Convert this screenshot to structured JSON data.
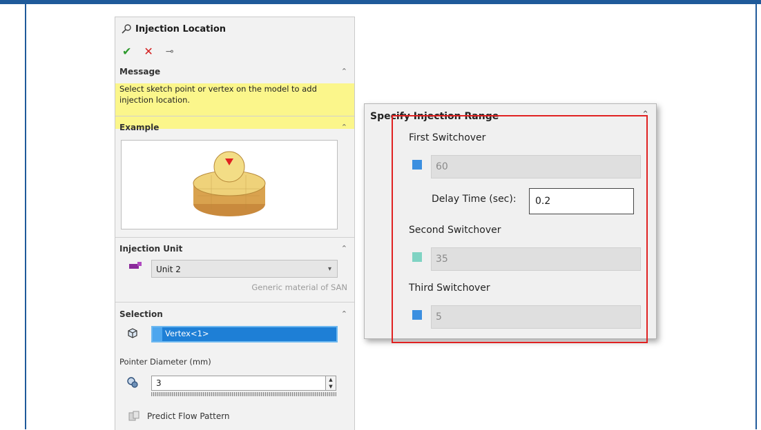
{
  "left_panel": {
    "title": "Injection Location",
    "actions": {
      "ok": "✔",
      "cancel": "✕",
      "pin": "⊸"
    },
    "message": {
      "header": "Message",
      "text": "Select sketch point or vertex on the model to add injection location."
    },
    "example": {
      "header": "Example"
    },
    "injection_unit": {
      "header": "Injection Unit",
      "selected": "Unit 2",
      "note": "Generic material of SAN"
    },
    "selection": {
      "header": "Selection",
      "value": "Vertex<1>",
      "pointer_diameter_label": "Pointer Diameter (mm)",
      "pointer_diameter_value": "3",
      "predict_label": "Predict Flow Pattern"
    }
  },
  "right_panel": {
    "title": "Specify Injection Range",
    "first_switchover": {
      "label": "First Switchover",
      "value": "60",
      "color": "#3b8fe0"
    },
    "delay": {
      "label": "Delay Time (sec):",
      "value": "0.2"
    },
    "second_switchover": {
      "label": "Second Switchover",
      "value": "35",
      "color": "#7fd3c3"
    },
    "third_switchover": {
      "label": "Third Switchover",
      "value": "5",
      "color": "#3b8fe0"
    }
  },
  "colors": {
    "highlight": "#e02020",
    "message_bg": "#fbf68b",
    "frame": "#1f5a9a"
  }
}
